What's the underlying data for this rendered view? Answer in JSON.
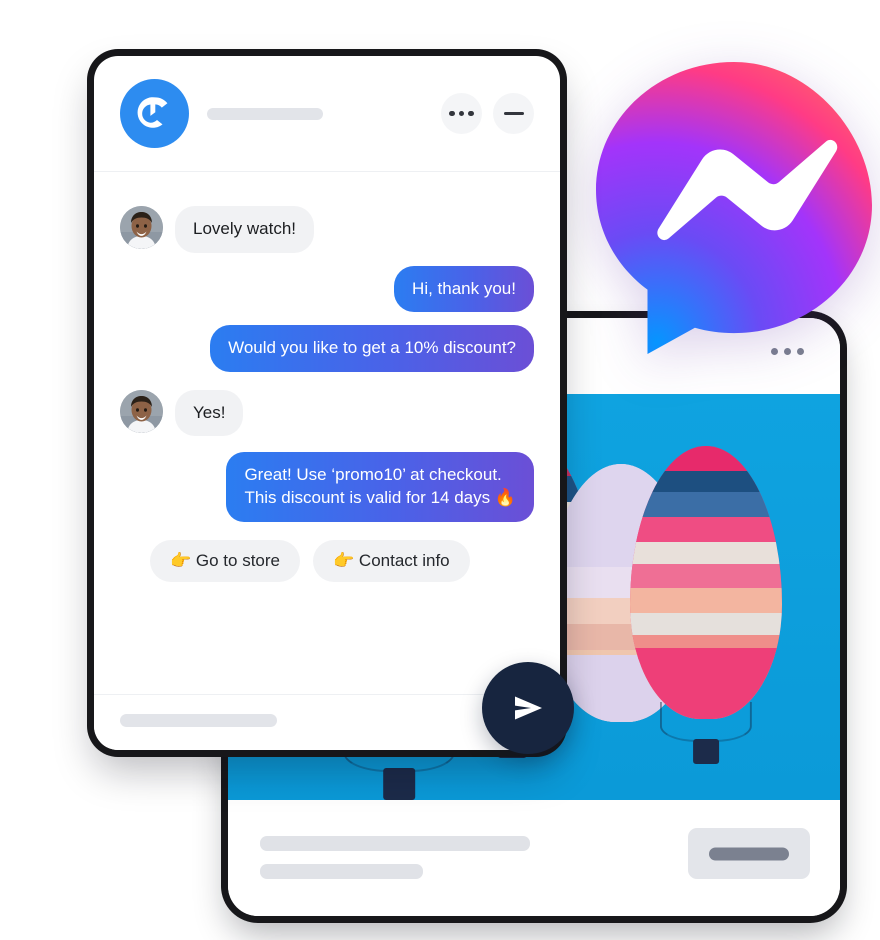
{
  "scene": {
    "title": "Messenger chat widget marketing illustration"
  },
  "colors": {
    "brand_blue": "#2d8cf0",
    "bubble_gradient_start": "#2b7df1",
    "bubble_gradient_end": "#6b4fd6",
    "incoming_bubble": "#f1f2f4",
    "send_button": "#17253f",
    "sky": "#0d9fdd",
    "placeholder_gray": "#e2e4e9"
  },
  "chat_window": {
    "header": {
      "logo_letter": "C",
      "logo_icon": "brand-c-logo-icon",
      "title_placeholder": "",
      "more_button_label": "",
      "minimize_button_label": ""
    },
    "messages": [
      {
        "id": "m1",
        "direction": "in",
        "text": "Lovely watch!",
        "has_avatar": true
      },
      {
        "id": "m2",
        "direction": "out",
        "text": "Hi, thank you!",
        "has_avatar": false
      },
      {
        "id": "m3",
        "direction": "out",
        "text": "Would you like to get a 10% discount?",
        "has_avatar": false
      },
      {
        "id": "m4",
        "direction": "in",
        "text": "Yes!",
        "has_avatar": true
      },
      {
        "id": "m5",
        "direction": "out",
        "line1": "Great! Use ‘promo10’ at checkout.",
        "line2": "This discount is valid for 14 days 🔥",
        "has_avatar": false
      }
    ],
    "quick_replies": [
      {
        "id": "q1",
        "emoji": "👉",
        "label": "Go to store"
      },
      {
        "id": "q2",
        "emoji": "👉",
        "label": "Contact info"
      }
    ],
    "footer": {
      "input_placeholder": ""
    }
  },
  "send_button": {
    "icon": "send-paper-plane-icon",
    "label": ""
  },
  "messenger_logo": {
    "icon": "messenger-bolt-icon",
    "gradient": [
      "#0695ff",
      "#a334fa",
      "#ff5c87",
      "#ff7061"
    ]
  },
  "phone": {
    "topbar": {
      "menu_icon": "more-dots-icon"
    },
    "photo": {
      "alt": "Four striped hot air balloons in a blue sky",
      "sky_color": "#0d9fdd",
      "balloon_count": 4
    },
    "footer": {
      "line1_placeholder": "",
      "line2_placeholder": "",
      "action_button_label": ""
    }
  }
}
